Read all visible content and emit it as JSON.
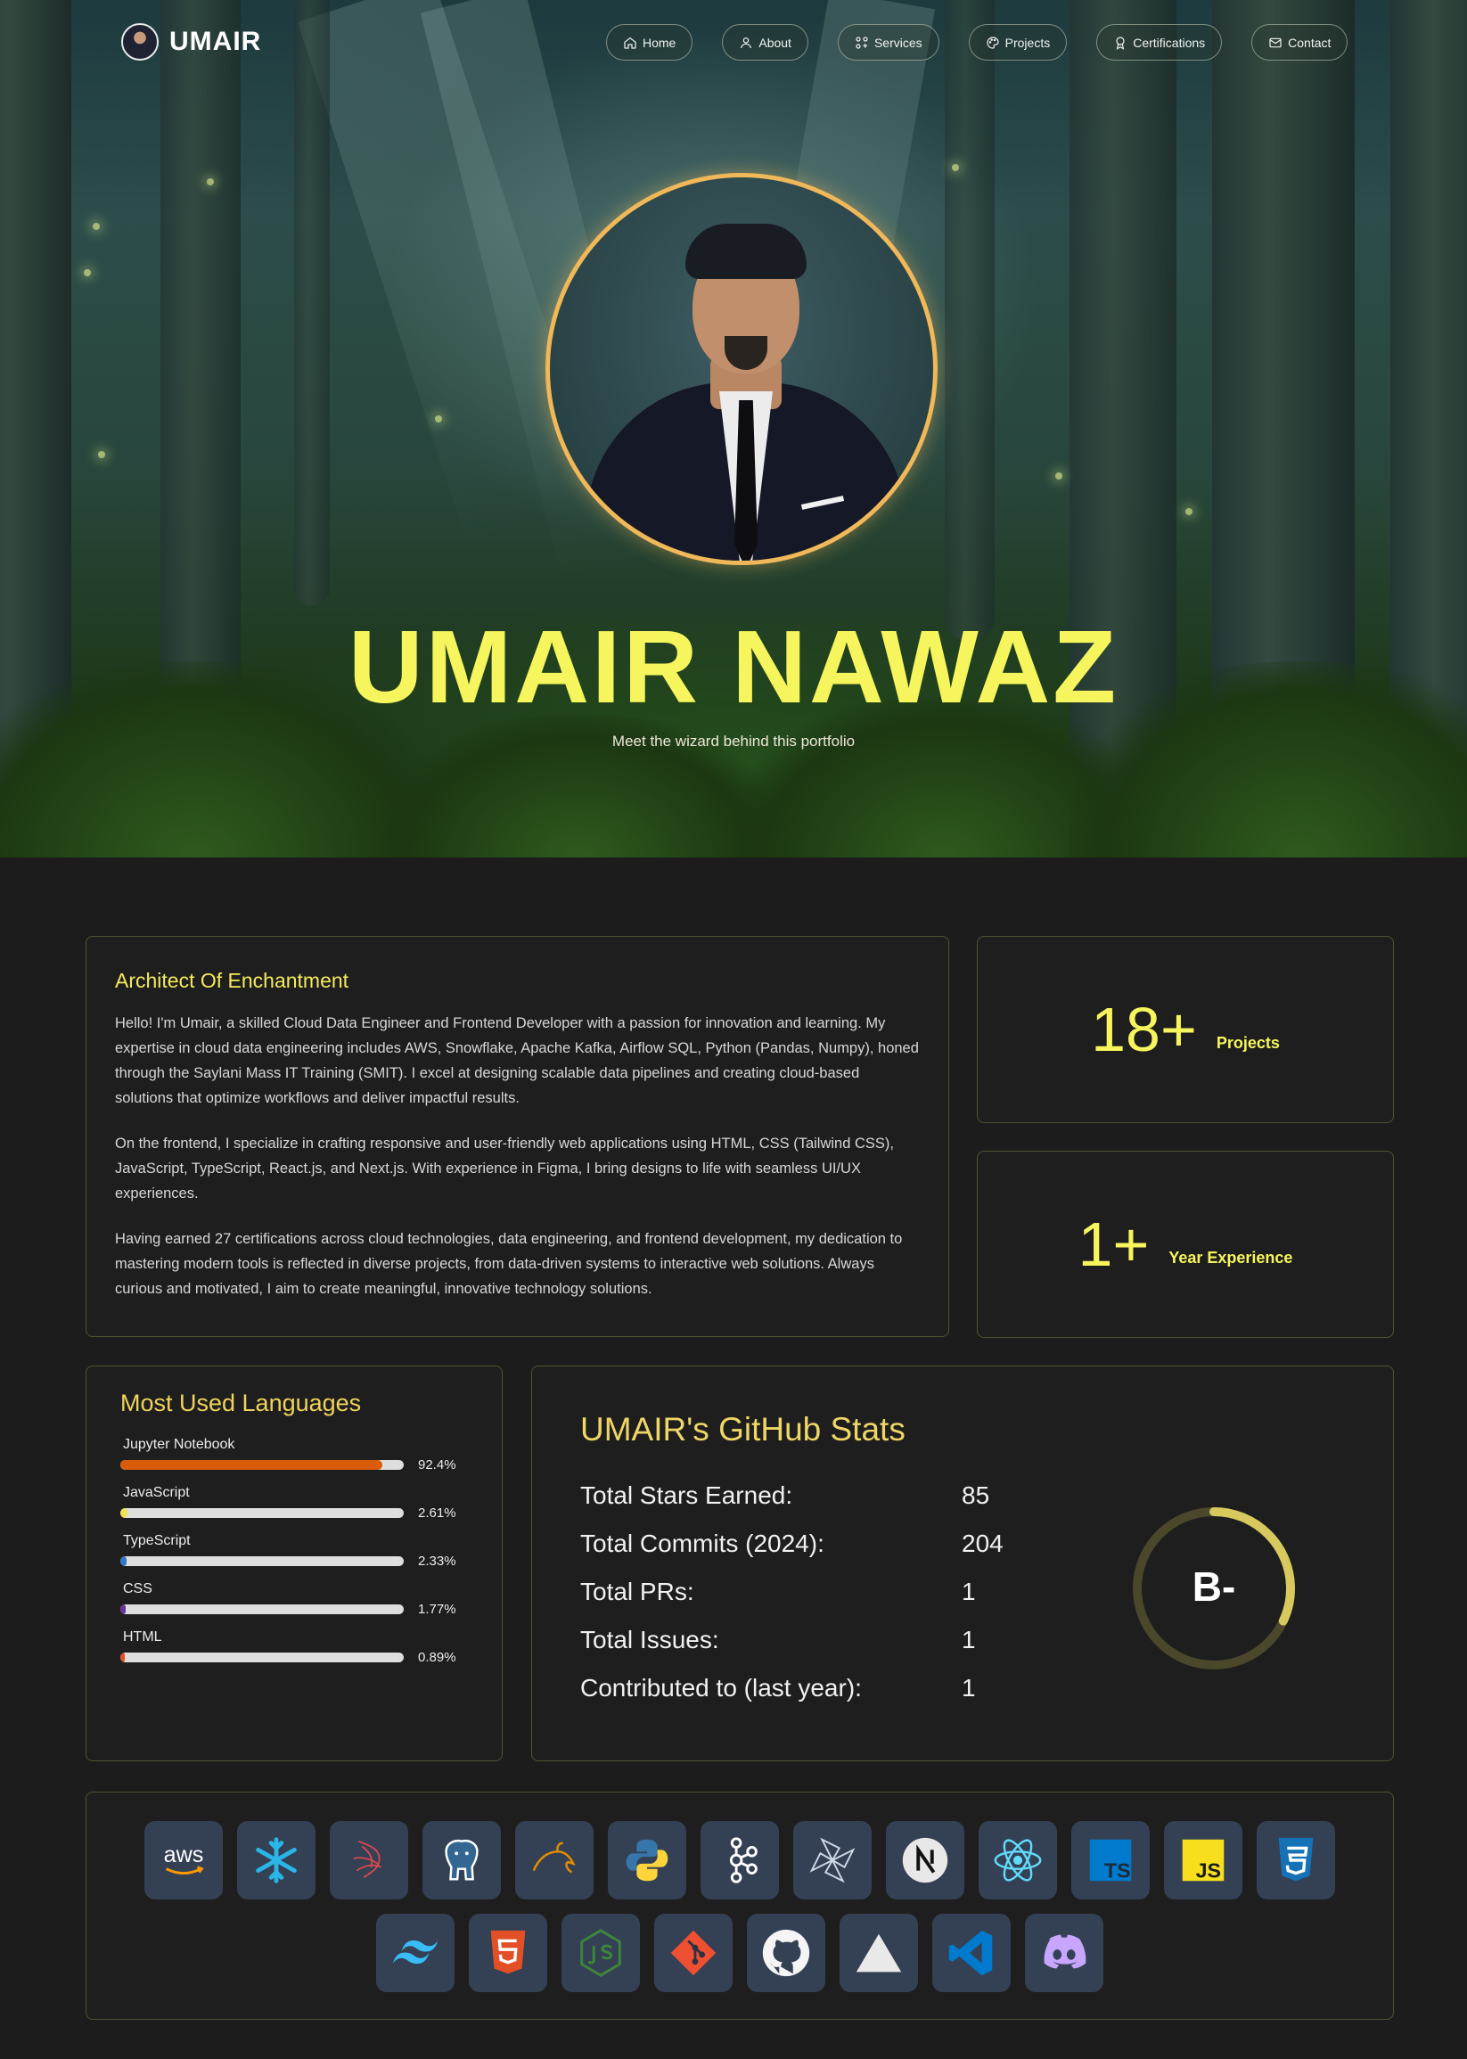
{
  "nav": {
    "brand": "UMAIR",
    "links": [
      {
        "label": "Home",
        "icon": "home-icon"
      },
      {
        "label": "About",
        "icon": "user-icon"
      },
      {
        "label": "Services",
        "icon": "services-icon"
      },
      {
        "label": "Projects",
        "icon": "palette-icon"
      },
      {
        "label": "Certifications",
        "icon": "award-icon"
      },
      {
        "label": "Contact",
        "icon": "mail-icon"
      }
    ]
  },
  "hero": {
    "title": "UMAIR NAWAZ",
    "subtitle": "Meet the wizard behind this portfolio"
  },
  "about": {
    "heading": "Architect Of Enchantment",
    "paragraphs": [
      "Hello! I'm Umair, a skilled Cloud Data Engineer and Frontend Developer with a passion for innovation and learning. My expertise in cloud data engineering includes AWS, Snowflake, Apache Kafka, Airflow SQL, Python (Pandas, Numpy), honed through the Saylani Mass IT Training (SMIT). I excel at designing scalable data pipelines and creating cloud-based solutions that optimize workflows and deliver impactful results.",
      "On the frontend, I specialize in crafting responsive and user-friendly web applications using HTML, CSS (Tailwind CSS), JavaScript, TypeScript, React.js, and Next.js. With experience in Figma, I bring designs to life with seamless UI/UX experiences.",
      "Having earned 27 certifications across cloud technologies, data engineering, and frontend development, my dedication to mastering modern tools is reflected in diverse projects, from data-driven systems to interactive web solutions. Always curious and motivated, I aim to create meaningful, innovative technology solutions."
    ]
  },
  "stats": [
    {
      "value": "18+",
      "label": "Projects"
    },
    {
      "value": "1+",
      "label": "Year Experience"
    }
  ],
  "languages": {
    "heading": "Most Used Languages",
    "items": [
      {
        "name": "Jupyter Notebook",
        "percent": "92.4%",
        "fraction": 0.924,
        "color": "#DA5B0B"
      },
      {
        "name": "JavaScript",
        "percent": "2.61%",
        "fraction": 0.0261,
        "color": "#F1E05A"
      },
      {
        "name": "TypeScript",
        "percent": "2.33%",
        "fraction": 0.0233,
        "color": "#3178C6"
      },
      {
        "name": "CSS",
        "percent": "1.77%",
        "fraction": 0.0177,
        "color": "#663399"
      },
      {
        "name": "HTML",
        "percent": "0.89%",
        "fraction": 0.0089,
        "color": "#E34C26"
      }
    ]
  },
  "github": {
    "heading": "UMAIR's GitHub Stats",
    "rows": [
      {
        "label": "Total Stars Earned:",
        "value": "85"
      },
      {
        "label": "Total Commits (2024):",
        "value": "204"
      },
      {
        "label": "Total PRs:",
        "value": "1"
      },
      {
        "label": "Total Issues:",
        "value": "1"
      },
      {
        "label": "Contributed to (last year):",
        "value": "1"
      }
    ],
    "grade": "B-",
    "grade_progress": 0.32,
    "ring_color": "#D7C95D",
    "ring_track": "#4A472B"
  },
  "tech_stack": {
    "row1": [
      "aws-icon",
      "snowflake-icon",
      "sql-server-icon",
      "postgresql-icon",
      "mysql-icon",
      "python-icon",
      "kafka-icon",
      "airflow-icon",
      "nextjs-icon",
      "react-icon",
      "typescript-icon",
      "javascript-icon",
      "css3-icon"
    ],
    "row2": [
      "tailwind-icon",
      "html5-icon",
      "nodejs-icon",
      "git-icon",
      "github-icon",
      "vercel-icon",
      "vscode-icon",
      "discord-icon"
    ],
    "aws_text": "aws",
    "ts_text": "TS",
    "js_text": "JS"
  },
  "colors": {
    "accent": "#F7F55D",
    "card_border": "#4F5332",
    "page_bg": "#1C1C1C"
  }
}
